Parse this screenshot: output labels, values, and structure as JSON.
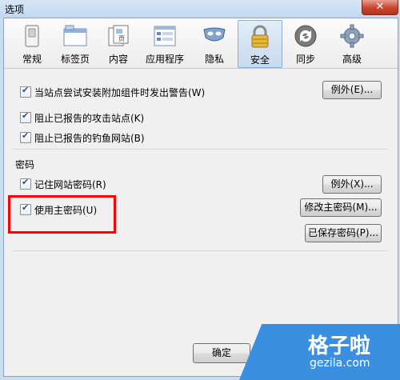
{
  "window": {
    "title": "选项",
    "close_label": "✕"
  },
  "tabs": [
    {
      "label": "常规",
      "icon": "switch-icon"
    },
    {
      "label": "标签页",
      "icon": "tabs-icon"
    },
    {
      "label": "内容",
      "icon": "page-icon"
    },
    {
      "label": "应用程序",
      "icon": "applications-icon"
    },
    {
      "label": "隐私",
      "icon": "mask-icon"
    },
    {
      "label": "安全",
      "icon": "lock-icon",
      "selected": true
    },
    {
      "label": "同步",
      "icon": "sync-icon"
    },
    {
      "label": "高级",
      "icon": "gear-icon"
    }
  ],
  "security": {
    "warn_addons": "当站点尝试安装附加组件时发出警告(W)",
    "exceptions_1": "例外(E)...",
    "block_attack": "阻止已报告的攻击站点(K)",
    "block_forgery": "阻止已报告的钓鱼网站(B)"
  },
  "passwords": {
    "group_label": "密码",
    "remember": "记住网站密码(R)",
    "exceptions_2": "例外(X)...",
    "use_master": "使用主密码(U)",
    "change_master": "修改主密码(M)...",
    "saved": "已保存密码(P)..."
  },
  "footer": {
    "ok": "确定"
  },
  "watermark": {
    "brand_cn": "格子啦",
    "brand_url": "gezila.com"
  },
  "colors": {
    "accent": "#2a4f9e",
    "highlight": "#ff0000",
    "watermark": "#3a8fe0"
  }
}
